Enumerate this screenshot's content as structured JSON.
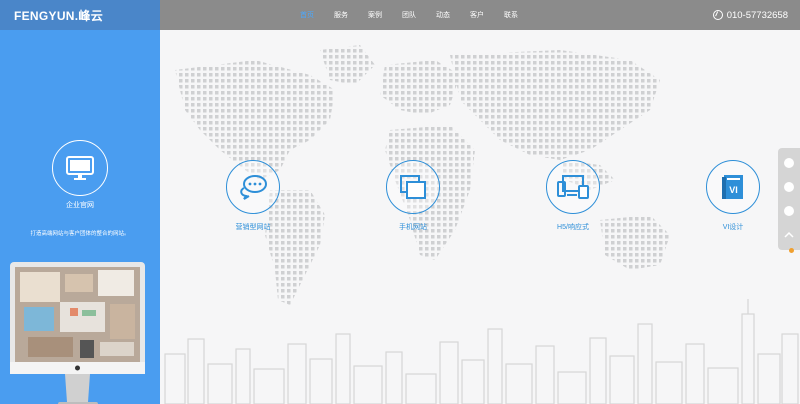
{
  "header": {
    "logo": "FENGYUN.峰云",
    "nav": [
      "首页",
      "服务",
      "案例",
      "团队",
      "动态",
      "客户",
      "联系"
    ],
    "active_index": 0,
    "phone": "010-57732658"
  },
  "left_panel": {
    "title": "企业官网",
    "description": "打造高端网站与客户团体的整合的网站。"
  },
  "services": [
    {
      "label": "营销型网站",
      "icon": "chat-bubbles-icon"
    },
    {
      "label": "手机网站",
      "icon": "windows-icon"
    },
    {
      "label": "H5/响应式",
      "icon": "devices-icon"
    },
    {
      "label": "VI设计",
      "icon": "vi-book-icon",
      "badge": "VI"
    }
  ],
  "colors": {
    "header_bg": "#8b8b8b",
    "logo_bg": "#4a86c9",
    "panel_bg": "#4a9df0",
    "accent": "#2e8fd8",
    "nav_active": "#4aa8ff"
  }
}
